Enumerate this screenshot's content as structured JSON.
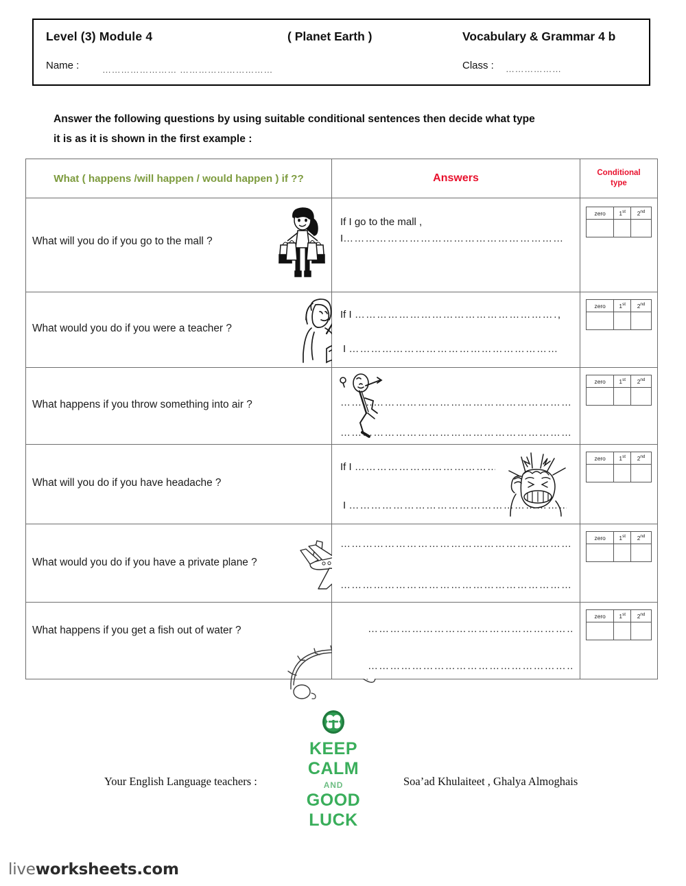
{
  "header": {
    "level_module": "Level (3)  Module 4",
    "topic": "(  Planet Earth   )",
    "subject": "Vocabulary & Grammar    4 b",
    "name_label": "Name :",
    "name_value": "…………………… …………………………………",
    "class_label": "Class :",
    "class_value": "………………"
  },
  "instructions": {
    "line1": "Answer the following questions  by using  suitable conditional sentences then decide what type",
    "line2": "it is as it is shown in the first example :"
  },
  "table": {
    "headers": {
      "question": "What (  happens /will happen / would happen ) if ??",
      "answers": "Answers",
      "conditional_line1": "Conditional",
      "conditional_line2": "type"
    },
    "conditional_options": [
      "zero",
      "1st",
      "2nd"
    ],
    "rows": [
      {
        "question": "What will you do if you go to the mall  ?",
        "illustration": "shopping-girl-illustration",
        "answer_line1_prefix": "If I go to the mall  ,",
        "answer_line2_prefix": "I",
        "answer_line1_dots": "",
        "answer_line2_dots": "…………………………………………………………………………………",
        "answer_suffix": ""
      },
      {
        "question": "What would you do if you were a teacher ?",
        "illustration": "teacher-globe-illustration",
        "answer_line1_prefix": "If I",
        "answer_line2_prefix": "I",
        "answer_line1_dots": "………………………………………………………………",
        "answer_line2_dots": "……………………………………………………………",
        "answer_suffix": ","
      },
      {
        "question": "What happens if you throw something into air ?",
        "illustration": "stick-figure-throwing-illustration",
        "answer_line1_prefix": "",
        "answer_line2_prefix": "",
        "answer_line1_dots": "………………………………………………………………………",
        "answer_line2_dots": "…………………………………………………………………………",
        "answer_suffix": ""
      },
      {
        "question": "What will you do if you have headache ?",
        "illustration": "headache-person-illustration",
        "answer_line1_prefix": "If I",
        "answer_line2_prefix": "I",
        "answer_line1_dots": "…………………………………………",
        "answer_line2_dots": "……………………………………………………………………",
        "answer_suffix": ""
      },
      {
        "question": "What would you do if you have a private plane ?",
        "illustration": "airplane-illustration",
        "answer_line1_prefix": "",
        "answer_line2_prefix": "",
        "answer_line1_dots": "……………………………………………………………………",
        "answer_line2_dots": "…………………………………………………………………",
        "answer_suffix": ""
      },
      {
        "question": "What happens if you get a fish out of water ?",
        "illustration": "fishing-rod-illustration",
        "answer_line1_prefix": "",
        "answer_line2_prefix": "",
        "answer_line1_dots": "………………………………………………………",
        "answer_line2_dots": "………………………………………………………",
        "answer_suffix": ""
      }
    ]
  },
  "footer": {
    "keep_calm": {
      "line1": "KEEP",
      "line2": "CALM",
      "line3": "AND",
      "line4": "GOOD",
      "line5": "LUCK",
      "color": "#3aae5b"
    },
    "teachers_label": "Your English Language teachers :",
    "teachers_names": "Soa’ad Khulaiteet , Ghalya Almoghais"
  },
  "watermark": {
    "light": "live",
    "bold": "worksheets.com"
  }
}
